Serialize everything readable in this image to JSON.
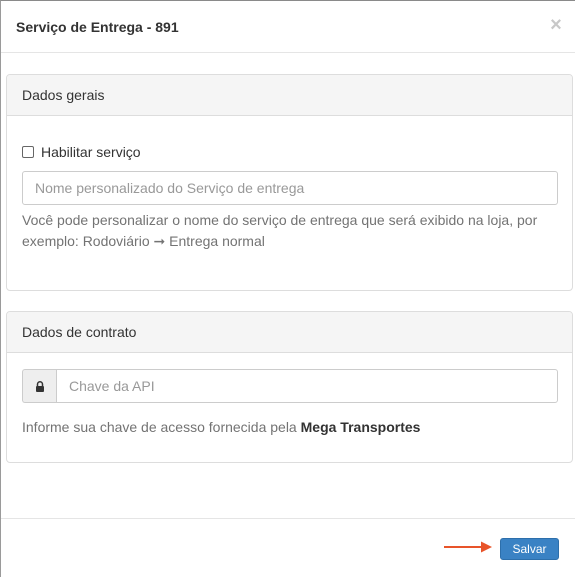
{
  "modal": {
    "title": "Serviço de Entrega - 891",
    "close_symbol": "×"
  },
  "general_panel": {
    "heading": "Dados gerais",
    "enable_label": "Habilitar serviço",
    "enable_checked": false,
    "name_input": {
      "value": "",
      "placeholder": "Nome personalizado do Serviço de entrega"
    },
    "help_before_arrow": "Você pode personalizar o nome do serviço de entrega que será exibido na loja, por exemplo: Rodoviário",
    "help_arrow": "➞",
    "help_after_arrow": "Entrega normal"
  },
  "contract_panel": {
    "heading": "Dados de contrato",
    "addon_icon": "lock-icon",
    "api_input": {
      "value": "",
      "placeholder": "Chave da API"
    },
    "help_prefix": "Informe sua chave de acesso fornecida pela",
    "help_strong": "Mega Transportes"
  },
  "footer": {
    "save_label": "Salvar",
    "annotation_arrow_color": "#e8542a",
    "save_button_color": "#3a82c4"
  }
}
